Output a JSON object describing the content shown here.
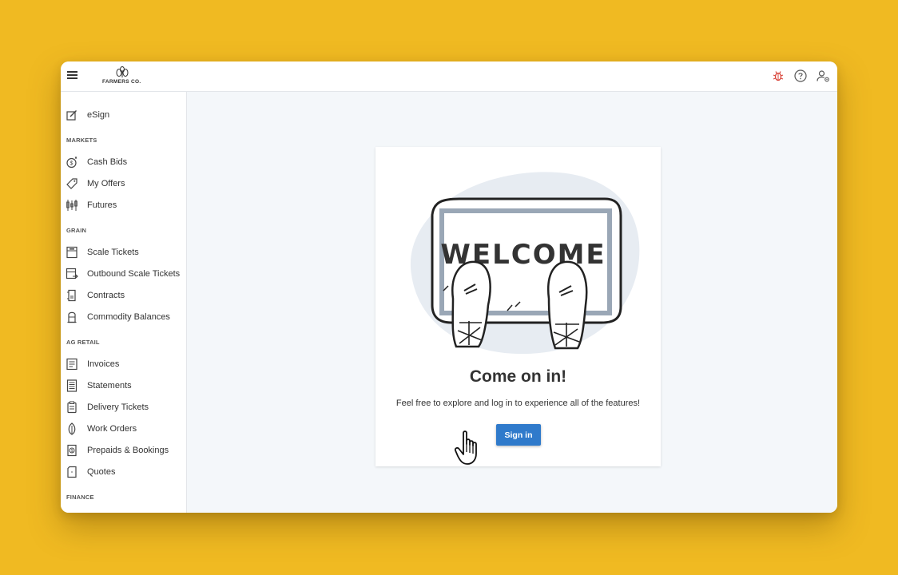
{
  "app": {
    "logo_text": "FARMERS CO."
  },
  "sidebar": {
    "items": [
      {
        "label": "eSign",
        "icon": "pencil-square-icon"
      },
      {
        "label": "Cash Bids",
        "icon": "coin-icon"
      },
      {
        "label": "My Offers",
        "icon": "tag-icon"
      },
      {
        "label": "Futures",
        "icon": "candlestick-icon"
      },
      {
        "label": "Scale Tickets",
        "icon": "scale-ticket-icon"
      },
      {
        "label": "Outbound Scale Tickets",
        "icon": "outbound-ticket-icon"
      },
      {
        "label": "Contracts",
        "icon": "contract-icon"
      },
      {
        "label": "Commodity Balances",
        "icon": "silo-icon"
      },
      {
        "label": "Invoices",
        "icon": "invoice-icon"
      },
      {
        "label": "Statements",
        "icon": "statement-icon"
      },
      {
        "label": "Delivery Tickets",
        "icon": "clipboard-icon"
      },
      {
        "label": "Work Orders",
        "icon": "leaf-icon"
      },
      {
        "label": "Prepaids & Bookings",
        "icon": "prepaid-icon"
      },
      {
        "label": "Quotes",
        "icon": "quote-icon"
      }
    ],
    "sections": {
      "markets": "MARKETS",
      "grain": "GRAIN",
      "ag_retail": "AG RETAIL",
      "finance": "FINANCE"
    }
  },
  "welcome_card": {
    "mat_text": "WELCOME",
    "title": "Come on in!",
    "subtitle": "Feel free to explore and log in to experience all of the features!",
    "signin_label": "Sign in"
  },
  "colors": {
    "background": "#F0BA22",
    "primary_button": "#2F7ACB",
    "bug_icon": "#D9453B",
    "main_bg": "#F4F7FA"
  }
}
